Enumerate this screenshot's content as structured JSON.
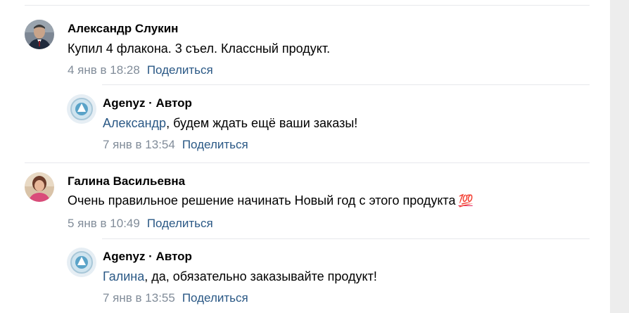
{
  "comments": [
    {
      "author": "Александр Слукин",
      "text": "Купил 4 флакона. 3 съел. Классный продукт.",
      "date": "4 янв в 18:28",
      "share_label": "Поделиться",
      "reply": {
        "author": "Agenyz · Автор",
        "mention": "Александр",
        "text": ", будем ждать ещё ваши заказы!",
        "date": "7 янв в 13:54",
        "share_label": "Поделиться"
      }
    },
    {
      "author": "Галина Васильевна",
      "text": "Очень правильное решение начинать Новый год с этого продукта",
      "emoji": "💯",
      "date": "5 янв в 10:49",
      "share_label": "Поделиться",
      "reply": {
        "author": "Agenyz · Автор",
        "mention": "Галина",
        "text": ", да, обязательно заказывайте продукт!",
        "date": "7 янв в 13:55",
        "share_label": "Поделиться"
      }
    }
  ]
}
